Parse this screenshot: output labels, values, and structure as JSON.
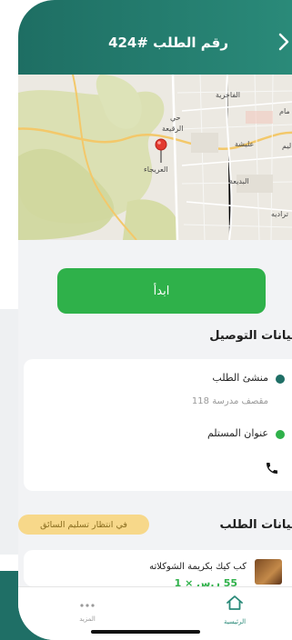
{
  "header": {
    "title": "رقم الطلب #424",
    "back_icon": "chevron-right-icon"
  },
  "map": {
    "labels": [
      "الفاخرية",
      "حي",
      "الرقيعة",
      "عليشة",
      "العريجاء",
      "البديعة",
      "مام",
      "ليم",
      "تراديه"
    ],
    "pin_icon": "map-pin-icon"
  },
  "actions": {
    "start_label": "ابدأ"
  },
  "delivery": {
    "section_title": "بيانات التوصيل",
    "origin_label": "منشئ الطلب",
    "origin_value": "مقصف مدرسة 118",
    "recipient_label": "عنوان المستلم",
    "phone_icon": "phone-icon"
  },
  "order": {
    "section_title": "بيانات الطلب",
    "status": "في انتظار تسليم السائق",
    "items": [
      {
        "name": "كب كيك بكريمة الشوكلاته",
        "price": "55 ر.س × 1"
      }
    ]
  },
  "tabbar": {
    "more_label": "المزيد",
    "home_label": "الرئيسية"
  },
  "colors": {
    "header": "#1f6f66",
    "accent_green": "#2fb14a",
    "badge": "#f7d88a"
  }
}
